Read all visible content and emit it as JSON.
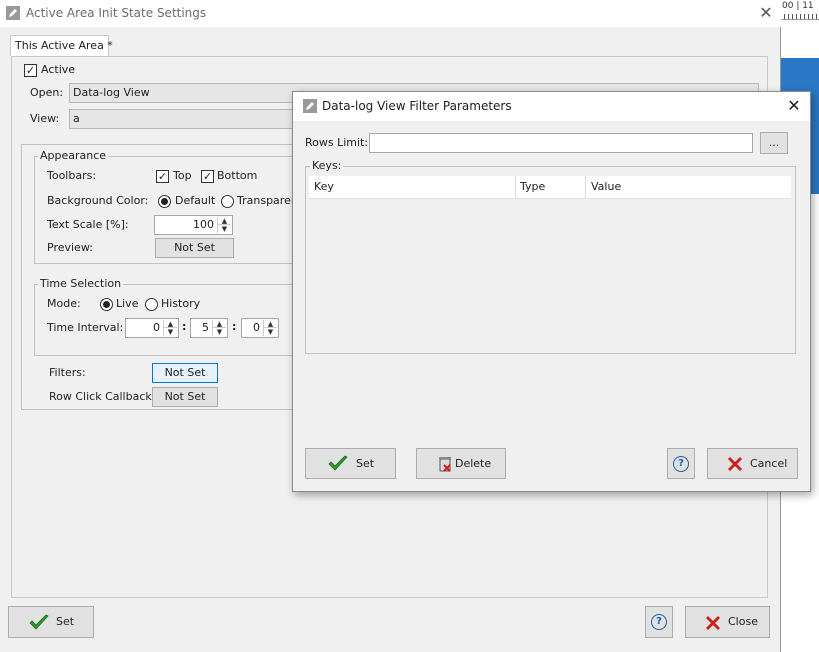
{
  "background": {
    "ruler_text": "00 | 11"
  },
  "main_window": {
    "title": "Active Area Init State Settings",
    "tab_label": "This Active Area *",
    "active_label": "Active",
    "active_checked": true,
    "open_label": "Open:",
    "open_value": "Data-log View",
    "view_label": "View:",
    "view_value": "a",
    "appearance": {
      "title": "Appearance",
      "toolbars_label": "Toolbars:",
      "top_label": "Top",
      "top_checked": true,
      "bottom_label": "Bottom",
      "bottom_checked": true,
      "bgcolor_label": "Background Color:",
      "default_label": "Default",
      "transparent_label": "Transparen",
      "selected_bg": "Default",
      "text_scale_label": "Text Scale [%]:",
      "text_scale_value": "100",
      "preview_label": "Preview:",
      "preview_button": "Not Set"
    },
    "time_selection": {
      "title": "Time Selection",
      "mode_label": "Mode:",
      "live_label": "Live",
      "history_label": "History",
      "selected_mode": "Live",
      "interval_label": "Time Interval:",
      "hours": "0",
      "minutes": "5",
      "seconds": "0",
      "separator": ":"
    },
    "filters_label": "Filters:",
    "filters_button": "Not Set",
    "row_click_label": "Row Click Callback:",
    "row_click_button": "Not Set",
    "set_button": "Set",
    "close_button": "Close"
  },
  "dialog": {
    "title": "Data-log View Filter Parameters",
    "rows_limit_label": "Rows Limit:",
    "rows_limit_value": "",
    "browse_button": "...",
    "keys_title": "Keys:",
    "columns": [
      "Key",
      "Type",
      "Value"
    ],
    "rows": [],
    "set_button": "Set",
    "delete_button": "Delete",
    "cancel_button": "Cancel"
  },
  "colors": {
    "accent": "#0078d7",
    "check_green": "#2e9b2e",
    "cancel_red": "#d11a1a",
    "help_blue": "#1c5fa8"
  },
  "icons": [
    "pencil-icon",
    "close-icon",
    "green-check-icon",
    "red-x-icon",
    "help-icon",
    "delete-icon"
  ]
}
